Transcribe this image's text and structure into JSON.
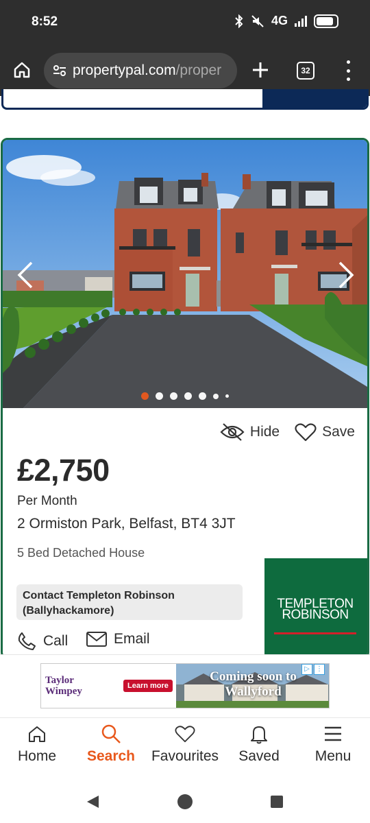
{
  "status_bar": {
    "time": "8:52",
    "network": "4G"
  },
  "browser": {
    "url_host": "propertypal.com",
    "url_path": "/proper",
    "tab_count": "32"
  },
  "listing": {
    "actions": {
      "hide": "Hide",
      "save": "Save"
    },
    "price": "£2,750",
    "price_qualifier": "Per Month",
    "address": "2 Ormiston Park, Belfast, BT4 3JT",
    "property_type": "5 Bed Detached House",
    "agent": "Contact Templeton Robinson (Ballyhackamore)",
    "call_label": "Call",
    "email_label": "Email",
    "agent_logo": {
      "line1": "TEMPLETON",
      "line2": "ROBINSON"
    },
    "gallery": {
      "dot_count": 7,
      "active_index": 0
    }
  },
  "ad": {
    "brand_line1": "Taylor",
    "brand_line2": "Wimpey",
    "cta": "Learn more",
    "headline_line1": "Coming soon to",
    "headline_line2": "Wallyford"
  },
  "bottom_nav": [
    {
      "label": "Home",
      "icon": "home-icon"
    },
    {
      "label": "Search",
      "icon": "search-icon",
      "active": true
    },
    {
      "label": "Favourites",
      "icon": "heart-icon"
    },
    {
      "label": "Saved",
      "icon": "bell-icon"
    },
    {
      "label": "Menu",
      "icon": "hamburger-icon"
    }
  ],
  "colors": {
    "accent": "#e8581c",
    "card_border": "#1a6b44",
    "agent_green": "#0e6b3e",
    "navy": "#0c2957"
  }
}
